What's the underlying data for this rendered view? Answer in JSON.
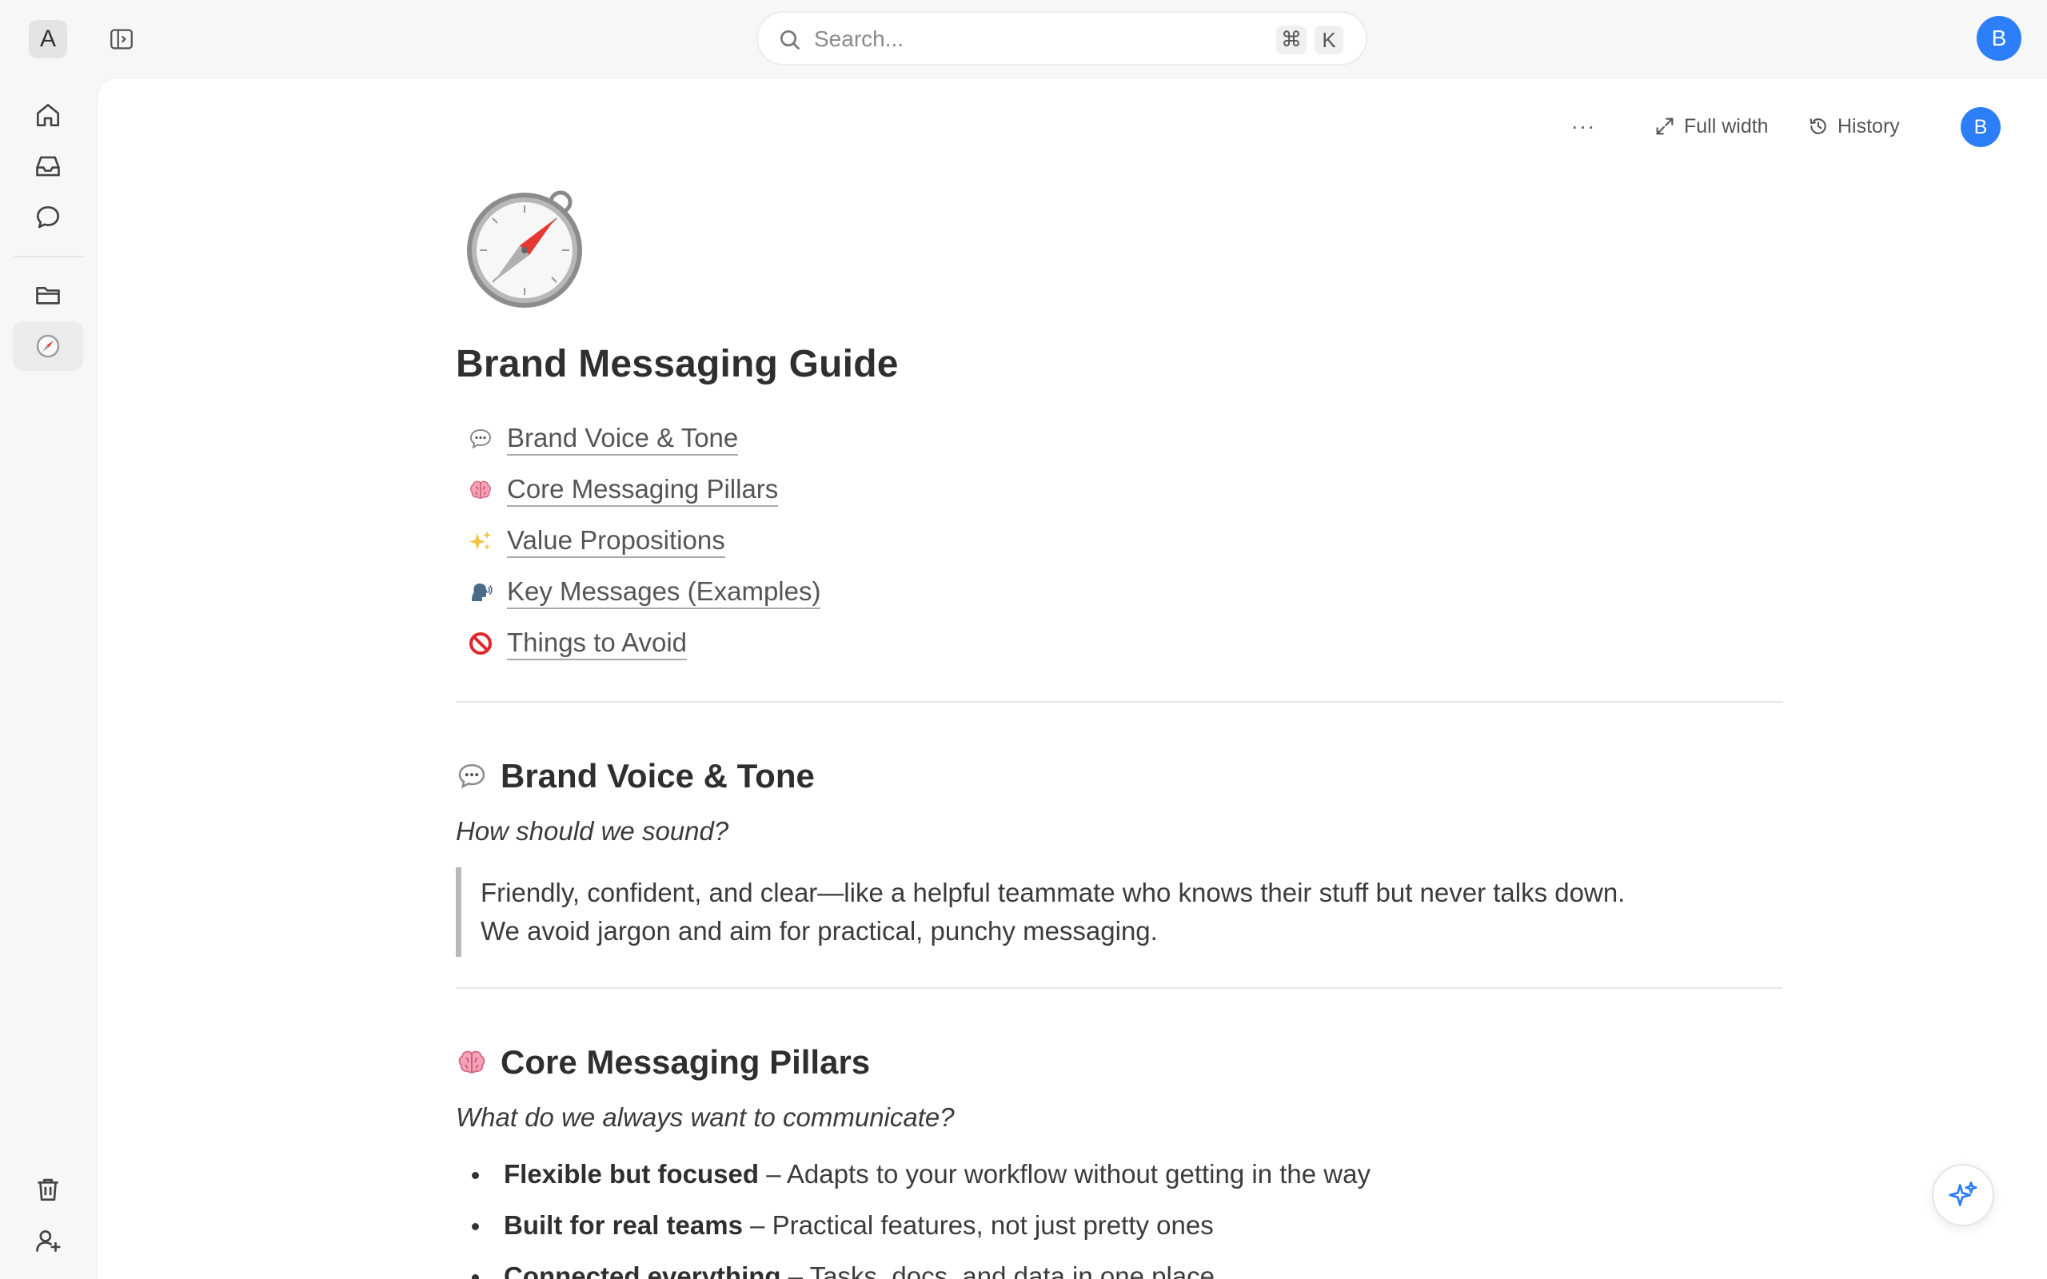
{
  "workspace": {
    "initial": "A"
  },
  "search": {
    "placeholder": "Search...",
    "shortcut_mod": "⌘",
    "shortcut_key": "K"
  },
  "user": {
    "initial": "B"
  },
  "colors": {
    "accent": "#2d7ff9",
    "text": "#333333",
    "muted": "#8a8a8a"
  },
  "sidebar": {
    "items": [
      {
        "name": "home",
        "icon": "home-icon"
      },
      {
        "name": "inbox",
        "icon": "inbox-icon"
      },
      {
        "name": "chat",
        "icon": "chat-icon"
      },
      {
        "name": "files",
        "icon": "folder-icon"
      },
      {
        "name": "brand-guide",
        "icon": "compass-icon",
        "active": true
      },
      {
        "name": "trash",
        "icon": "trash-icon"
      },
      {
        "name": "invite",
        "icon": "add-user-icon"
      }
    ]
  },
  "toolbar": {
    "more": "···",
    "full_width": "Full width",
    "history": "History"
  },
  "document": {
    "title": "Brand Messaging Guide",
    "toc": [
      {
        "emoji": "speech-bubble-icon",
        "label": "Brand Voice & Tone"
      },
      {
        "emoji": "brain-icon",
        "label": "Core Messaging Pillars"
      },
      {
        "emoji": "sparkles-icon",
        "label": "Value Propositions"
      },
      {
        "emoji": "speaking-head-icon",
        "label": "Key Messages (Examples)"
      },
      {
        "emoji": "prohibited-icon",
        "label": "Things to Avoid"
      }
    ],
    "sections": [
      {
        "heading": "Brand Voice & Tone",
        "question": "How should we sound?",
        "quote_line1": "Friendly, confident, and clear—like a helpful teammate who knows their stuff but never talks down.",
        "quote_line2": "We avoid jargon and aim for practical, punchy messaging."
      },
      {
        "heading": "Core Messaging Pillars",
        "question": "What do we always want to communicate?",
        "bullets": [
          {
            "bold": "Flexible but focused",
            "text": " – Adapts to your workflow without getting in the way"
          },
          {
            "bold": "Built for real teams",
            "text": " – Practical features, not just pretty ones"
          },
          {
            "bold": "Connected everything",
            "text": " – Tasks, docs, and data in one place"
          }
        ]
      }
    ]
  }
}
